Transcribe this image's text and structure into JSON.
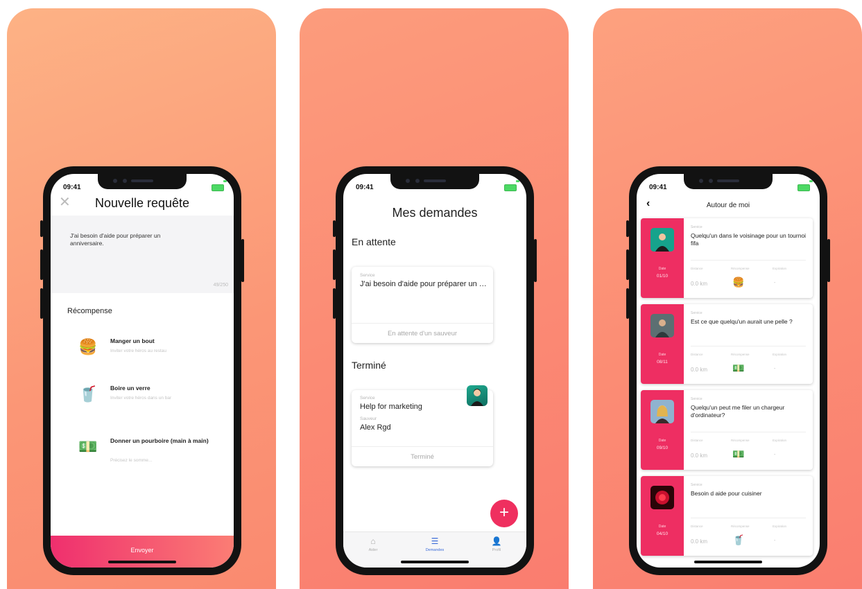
{
  "status_time": "09:41",
  "screen1": {
    "title": "Nouvelle requête",
    "request_text": "J'ai besoin d'aide pour préparer un anniversaire.",
    "char_count": "49/250",
    "reward_title": "Récompense",
    "rewards": [
      {
        "icon": "burger-icon",
        "glyph": "🍔",
        "name": "Manger un bout",
        "subtitle": "Inviter votre héros au restau"
      },
      {
        "icon": "drink-icon",
        "glyph": "🥤",
        "name": "Boire un verre",
        "subtitle": "Inviter votre héros dans un bar"
      },
      {
        "icon": "money-icon",
        "glyph": "💵",
        "name": "Donner un pourboire (main à main)",
        "subtitle": "Précisez le somme..."
      }
    ],
    "send_label": "Envoyer"
  },
  "screen2": {
    "title": "Mes demandes",
    "pending_header": "En attente",
    "pending_card": {
      "service_label": "Service",
      "service_value": "J'ai besoin d'aide pour préparer un anniversaire.",
      "footer": "En attente d'un sauveur"
    },
    "done_header": "Terminé",
    "done_card": {
      "service_label": "Service",
      "service_value": "Help for marketing",
      "helper_label": "Sauveur",
      "helper_value": "Alex Rgd",
      "footer": "Terminé"
    },
    "fab_glyph": "+",
    "tabs": [
      {
        "name": "Aider",
        "glyph": "⌂"
      },
      {
        "name": "Demandes",
        "glyph": "☰"
      },
      {
        "name": "Profil",
        "glyph": "👤"
      }
    ],
    "active_tab": "Demandes"
  },
  "screen3": {
    "title": "Autour de moi",
    "back_glyph": "‹",
    "labels": {
      "service": "Service",
      "date": "Date",
      "distance": "Distance",
      "reward": "Récompense",
      "expiration": "Expiration"
    },
    "cards": [
      {
        "service": "Quelqu'un dans le voisinage pour un tournoi fifa",
        "date": "01/10",
        "distance": "0.0 km",
        "reward": "burger-icon",
        "reward_glyph": "🍔",
        "expiration": "-"
      },
      {
        "service": "Est ce que quelqu'un aurait une pelle ?",
        "date": "08/11",
        "distance": "0.0 km",
        "reward": "money-icon",
        "reward_glyph": "💵",
        "expiration": "-"
      },
      {
        "service": "Quelqu'un peut me filer un chargeur d'ordinateur?",
        "date": "09/10",
        "distance": "0.0 km",
        "reward": "money-icon",
        "reward_glyph": "💵",
        "expiration": "-"
      },
      {
        "service": "Besoin d aide pour cuisiner",
        "date": "04/10",
        "distance": "0.0 km",
        "reward": "drink-icon",
        "reward_glyph": "🥤",
        "expiration": "-"
      }
    ]
  },
  "colors": {
    "accent": "#ee2e62",
    "gradient_start": "#ef2f6e",
    "gradient_end": "#fb7d74",
    "active_tab": "#3b6bd8"
  }
}
